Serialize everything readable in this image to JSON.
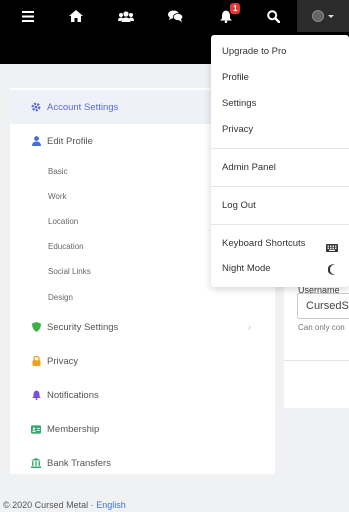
{
  "topnav": {
    "notification_count": "1",
    "icons": [
      "menu-icon",
      "home-icon",
      "users-icon",
      "chat-icon",
      "bell-icon",
      "search-icon"
    ]
  },
  "sidebar": {
    "account_settings": "Account Settings",
    "edit_profile": "Edit Profile",
    "sub_items": [
      "Basic",
      "Work",
      "Location",
      "Education",
      "Social Links",
      "Design"
    ],
    "security_settings": "Security Settings",
    "privacy": "Privacy",
    "notifications": "Notifications",
    "membership": "Membership",
    "bank_transfers": "Bank Transfers"
  },
  "main": {
    "field_label": "Username",
    "field_value": "CursedS",
    "field_hint": "Can only con"
  },
  "dropdown": {
    "upgrade": "Upgrade to Pro",
    "profile": "Profile",
    "settings": "Settings",
    "privacy": "Privacy",
    "admin_panel": "Admin Panel",
    "log_out": "Log Out",
    "keyboard_shortcuts": "Keyboard Shortcuts",
    "night_mode": "Night Mode"
  },
  "footer": {
    "copyright": "© 2020 Cursed Metal · ",
    "language": "English"
  },
  "colors": {
    "accent": "#5b6bd5",
    "topbar": "#000000",
    "badge": "#e53935",
    "link": "#3c77d6"
  }
}
